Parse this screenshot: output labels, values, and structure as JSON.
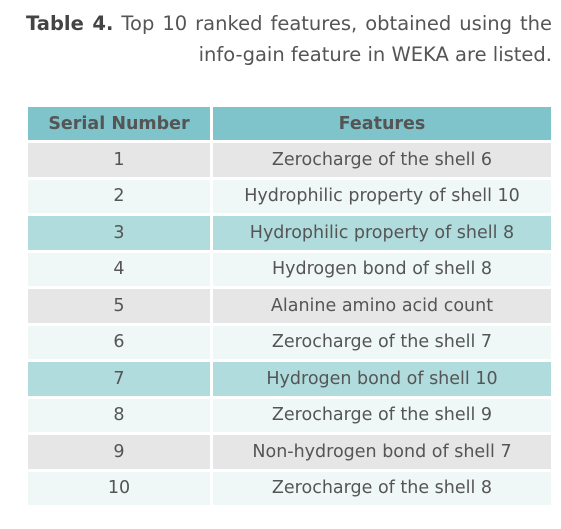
{
  "caption": {
    "label": "Table 4.",
    "text": " Top 10 ranked features, obtained using the info-gain feature in WEKA are listed."
  },
  "table": {
    "headers": [
      "Serial Number",
      "Features"
    ],
    "rows": [
      {
        "serial": "1",
        "feature": "Zerocharge of the shell 6",
        "shade": "gray"
      },
      {
        "serial": "2",
        "feature": "Hydrophilic property of shell 10",
        "shade": "light"
      },
      {
        "serial": "3",
        "feature": "Hydrophilic property of shell 8",
        "shade": "teal"
      },
      {
        "serial": "4",
        "feature": "Hydrogen bond of shell 8",
        "shade": "light"
      },
      {
        "serial": "5",
        "feature": "Alanine amino acid count",
        "shade": "gray"
      },
      {
        "serial": "6",
        "feature": "Zerocharge of the shell 7",
        "shade": "light"
      },
      {
        "serial": "7",
        "feature": "Hydrogen bond of shell 10",
        "shade": "teal"
      },
      {
        "serial": "8",
        "feature": "Zerocharge of the shell 9",
        "shade": "light"
      },
      {
        "serial": "9",
        "feature": "Non-hydrogen bond of shell 7",
        "shade": "gray"
      },
      {
        "serial": "10",
        "feature": "Zerocharge of the shell 8",
        "shade": "light"
      }
    ]
  },
  "colors": {
    "header": "#7fc3cb",
    "gray": "#e6e6e6",
    "light": "#eff7f7",
    "teal": "#b0dcdd"
  }
}
